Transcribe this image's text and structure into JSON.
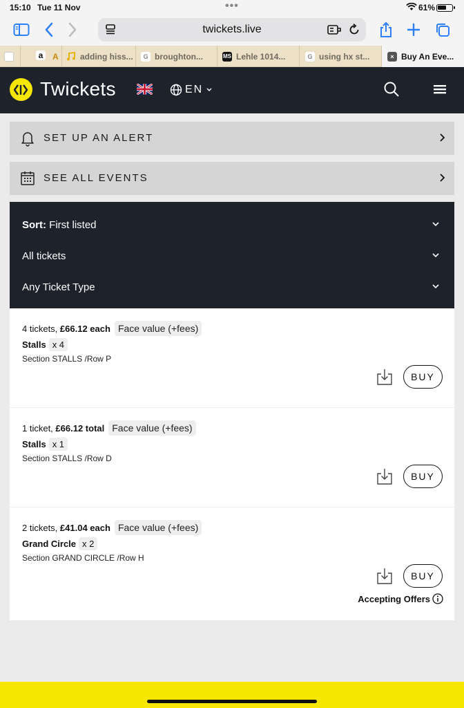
{
  "status_bar": {
    "time": "15:10",
    "date": "Tue 11 Nov",
    "battery": "61%",
    "battery_level": 0.61
  },
  "browser": {
    "url": "twickets.live",
    "tabs": [
      {
        "favicon": "a",
        "label": "A"
      },
      {
        "favicon": "",
        "label": "adding hiss..."
      },
      {
        "favicon": "G",
        "label": "broughton..."
      },
      {
        "favicon": "MS",
        "label": "Lehle 1014..."
      },
      {
        "favicon": "G",
        "label": "using hx st..."
      },
      {
        "favicon": "×",
        "label": "Buy An Eve...",
        "active": true
      }
    ]
  },
  "site": {
    "brand": "Twickets",
    "language": "EN",
    "colors": {
      "brand_yellow": "#f7e600",
      "header_dark": "#1e222b"
    }
  },
  "actions": {
    "alert_label": "SET UP AN ALERT",
    "events_label": "SEE ALL EVENTS"
  },
  "filters": {
    "sort_prefix": "Sort:",
    "sort_value": "First listed",
    "tickets": "All tickets",
    "ticket_type": "Any Ticket Type"
  },
  "listings": [
    {
      "count_text": "4 tickets,",
      "price_text": "£66.12 each",
      "face_value": "Face value (+fees)",
      "area": "Stalls",
      "qty": "x 4",
      "section": "Section STALLS /Row P",
      "buy_label": "BUY"
    },
    {
      "count_text": "1 ticket,",
      "price_text": "£66.12 total",
      "face_value": "Face value (+fees)",
      "area": "Stalls",
      "qty": "x 1",
      "section": "Section STALLS /Row D",
      "buy_label": "BUY"
    },
    {
      "count_text": "2 tickets,",
      "price_text": "£41.04 each",
      "face_value": "Face value (+fees)",
      "area": "Grand Circle",
      "qty": "x 2",
      "section": "Section GRAND CIRCLE /Row H",
      "buy_label": "BUY",
      "offers": "Accepting Offers"
    }
  ]
}
